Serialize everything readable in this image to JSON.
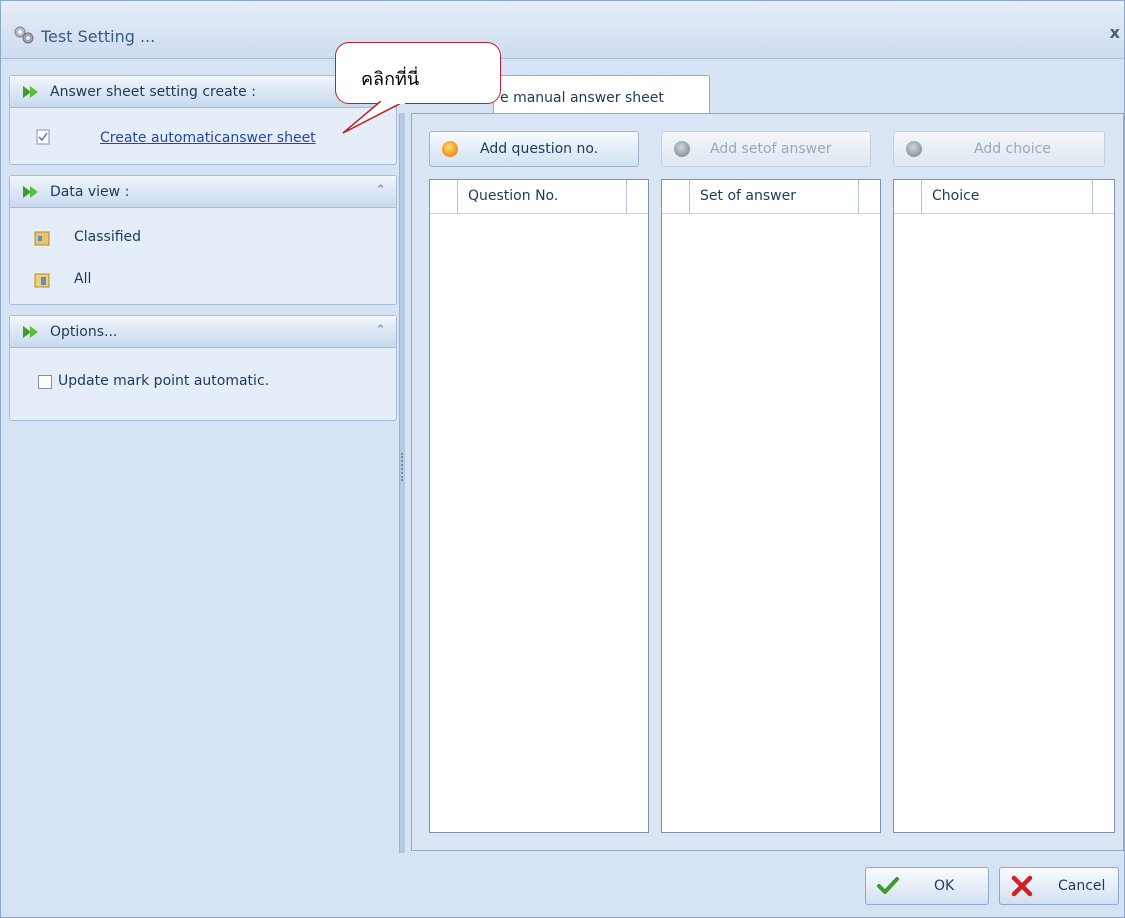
{
  "window": {
    "title": "Test Setting ...",
    "close_label": "x"
  },
  "left": {
    "answer_group": {
      "header": "Answer sheet setting create :",
      "link": "Create automaticanswer sheet"
    },
    "data_view": {
      "header": "Data view :",
      "items": [
        "Classified",
        "All"
      ]
    },
    "options": {
      "header": "Options...",
      "checkbox_label": "Update mark point automatic.",
      "checked": false
    }
  },
  "callout": {
    "text": "คลิกที่นี่"
  },
  "tabs": [
    {
      "label": "e manual answer sheet"
    }
  ],
  "toolbar": {
    "add_question": "Add question no.",
    "add_set": "Add setof answer",
    "add_choice": "Add choice"
  },
  "grids": {
    "question": {
      "header": "Question No."
    },
    "set": {
      "header": "Set of answer"
    },
    "choice": {
      "header": "Choice"
    }
  },
  "buttons": {
    "ok": "OK",
    "cancel": "Cancel"
  },
  "colors": {
    "accent_arrow": "#3f9a2a",
    "callout_border": "#c0202a",
    "link": "#2746a8"
  }
}
